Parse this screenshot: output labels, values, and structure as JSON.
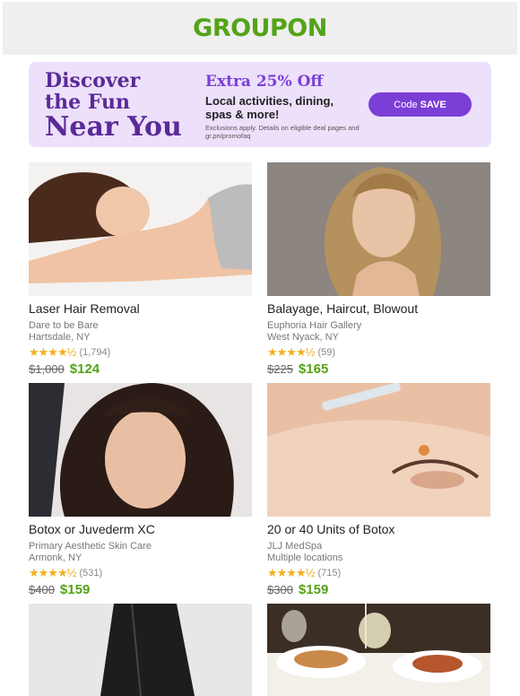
{
  "brand": {
    "logo_text": "GROUPON",
    "color": "#53a318"
  },
  "promo": {
    "line1": "Discover",
    "line2": "the Fun",
    "line3": "Near You",
    "headline": "Extra 25% Off",
    "subtext": "Local activities, dining, spas & more!",
    "fine_print": "Exclusions apply. Details on eligible deal pages and gr.pn/promofaq",
    "button_prefix": "Code",
    "button_code": "SAVE",
    "accent": "#7b3fd8",
    "background": "#ede0fb"
  },
  "deals": [
    {
      "title": "Laser Hair Removal",
      "merchant": "Dare to be Bare",
      "location": "Hartsdale, NY",
      "rating": 4.5,
      "reviews": "(1,794)",
      "old_price": "$1,000",
      "new_price": "$124"
    },
    {
      "title": "Balayage, Haircut, Blowout",
      "merchant": "Euphoria Hair Gallery",
      "location": "West Nyack, NY",
      "rating": 4.5,
      "reviews": "(59)",
      "old_price": "$225",
      "new_price": "$165"
    },
    {
      "title": "Botox or Juvederm XC",
      "merchant": "Primary Aesthetic Skin Care",
      "location": "Armonk, NY",
      "rating": 4.5,
      "reviews": "(531)",
      "old_price": "$400",
      "new_price": "$159"
    },
    {
      "title": "20 or 40 Units of Botox",
      "merchant": "JLJ MedSpa",
      "location": "Multiple locations",
      "rating": 4.5,
      "reviews": "(715)",
      "old_price": "$300",
      "new_price": "$159"
    }
  ],
  "icons": {
    "star": "star-icon",
    "half_star": "half-star-icon"
  }
}
